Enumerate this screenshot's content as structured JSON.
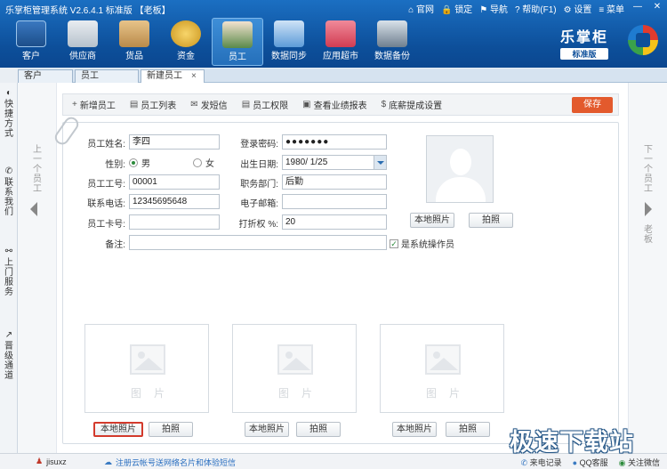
{
  "window": {
    "title": "乐掌柜管理系统 V2.6.4.1 标准版 【老板】",
    "links": [
      "官网",
      "锁定",
      "导航",
      "帮助(F1)",
      "设置",
      "菜单"
    ],
    "controls": [
      "—",
      "✕"
    ]
  },
  "nav": {
    "items": [
      "客户",
      "供应商",
      "货品",
      "资金",
      "员工",
      "数据同步",
      "应用超市",
      "数据备份"
    ],
    "active": "员工"
  },
  "brand": {
    "name": "乐掌柜",
    "edition": "标准版"
  },
  "tabs": [
    {
      "label": "客户"
    },
    {
      "label": "员工"
    },
    {
      "label": "新建员工",
      "close": "×"
    }
  ],
  "sidebar": {
    "items": [
      {
        "icon": "◐",
        "label": "快捷方式"
      },
      {
        "icon": "✆",
        "label": "联系我们"
      },
      {
        "icon": "⚯",
        "label": "上门服务"
      },
      {
        "icon": "↗",
        "label": "晋级通道"
      }
    ]
  },
  "nav_side": {
    "prev": "上一个员工",
    "next": "下一个员工",
    "boss": "老板"
  },
  "actions": {
    "items": [
      {
        "icon": "+",
        "label": "新增员工"
      },
      {
        "icon": "▤",
        "label": "员工列表"
      },
      {
        "icon": "✉",
        "label": "发短信"
      },
      {
        "icon": "▤",
        "label": "员工权限"
      },
      {
        "icon": "▣",
        "label": "查看业绩报表"
      },
      {
        "icon": "$",
        "label": "底薪提成设置"
      }
    ],
    "save": "保存"
  },
  "form": {
    "name_label": "员工姓名:",
    "name_value": "李四",
    "password_label": "登录密码:",
    "password_value": "●●●●●●●",
    "gender_label": "性别:",
    "gender_male": "男",
    "gender_female": "女",
    "birth_label": "出生日期:",
    "birth_value": "1980/ 1/25",
    "empno_label": "员工工号:",
    "empno_value": "00001",
    "dept_label": "职务部门:",
    "dept_value": "后勤",
    "phone_label": "联系电话:",
    "phone_value": "12345695648",
    "email_label": "电子邮箱:",
    "email_value": "",
    "card_label": "员工卡号:",
    "card_value": "",
    "discount_label": "打折权 %:",
    "discount_value": "20",
    "note_label": "备注:",
    "note_value": "",
    "operator_label": "是系统操作员",
    "operator_checked": "✓"
  },
  "photo_buttons": {
    "local": "本地照片",
    "shoot": "拍照"
  },
  "photo_slots": {
    "placeholder": "图片",
    "count_label": ""
  },
  "status": {
    "user": "jisuxz",
    "message": "注册云帐号送网络名片和体验短信",
    "right": [
      "来电记录",
      "QQ客服",
      "关注微信"
    ]
  },
  "watermark": "极速下载站",
  "colors": {
    "accent_blue": "#0d4f9a",
    "save_orange": "#e35a2d",
    "highlight_red": "#d33a2c"
  }
}
